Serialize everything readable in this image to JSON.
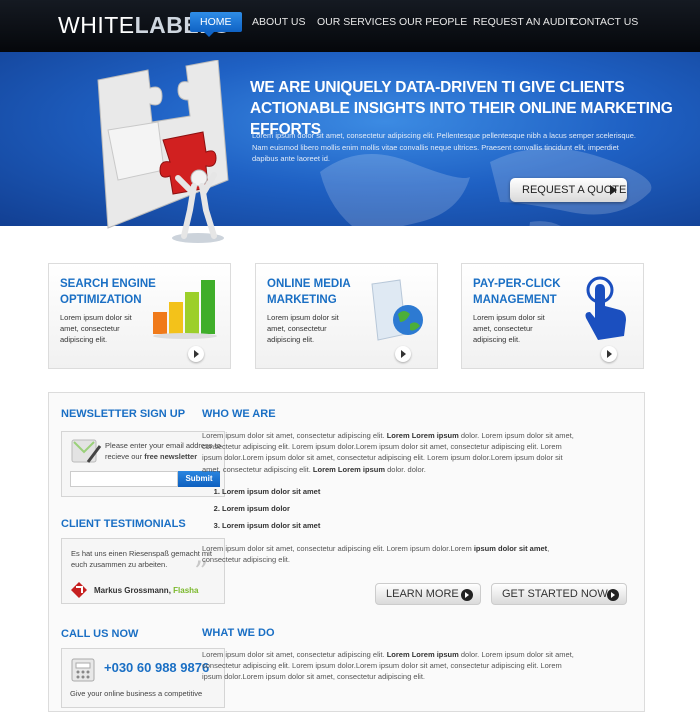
{
  "logo": {
    "part1": "WHITE",
    "part2": "LABELS"
  },
  "nav": {
    "items": [
      "HOME",
      "ABOUT US",
      "OUR SERVICES",
      "OUR PEOPLE",
      "REQUEST AN AUDIT",
      "CONTACT US"
    ]
  },
  "hero": {
    "title": "WE ARE UNIQUELY DATA-DRIVEN TI GIVE CLIENTS ACTIONABLE INSIGHTS INTO THEIR ONLINE MARKETING EFFORTS",
    "text": "Lorem ipsum dolor sit amet, consectetur adipiscing elit. Pellentesque pellentesque nibh a lacus semper scelerisque. Nam euismod libero mollis enim mollis vitae convallis neque ultrices. Praesent convallis tincidunt elit, imperdiet dapibus ante laoreet id.",
    "button": "REQUEST A QUOTE"
  },
  "services": [
    {
      "title": "SEARCH ENGINE OPTIMIZATION",
      "text": "Lorem ipsum dolor sit amet, consectetur adipiscing elit.",
      "icon": "bar-chart-icon"
    },
    {
      "title": "ONLINE MEDIA MARKETING",
      "text": "Lorem ipsum dolor sit amet, consectetur adipiscing elit.",
      "icon": "globe-folder-icon"
    },
    {
      "title": "PAY-PER-CLICK MANAGEMENT",
      "text": "Lorem ipsum dolor sit amet, consectetur adipiscing elit.",
      "icon": "hand-pointer-icon"
    }
  ],
  "newsletter": {
    "heading": "NEWSLETTER SIGN UP",
    "text1": "Please enter your email address to recieve our",
    "text2": "free newsletter",
    "button": "Submit"
  },
  "testimonials": {
    "heading": "CLIENT TESTIMONIALS",
    "text": "Es hat uns einen Riesenspaß gemacht mit euch zusammen zu arbeiten.",
    "name": "Markus Grossmann,",
    "company": "Flasha"
  },
  "call": {
    "heading": "CALL US NOW",
    "phone": "+030 60 988 9876",
    "text": "Give your online business a competitive"
  },
  "who": {
    "heading": "WHO WE ARE",
    "p1a": "Lorem ipsum dolor sit amet, consectetur adipiscing elit.",
    "p1b": "Lorem Lorem ipsum",
    "p1c": "dolor. Lorem ipsum dolor sit amet, consectetur adipiscing elit. Lorem  ipsum dolor.Lorem ipsum dolor sit amet, consectetur adipiscing elit. Lorem ipsum dolor.Lorem ipsum dolor sit amet, consectetur adipiscing elit. Lorem ipsum dolor.Lorem ipsum dolor sit amet, consectetur adipiscing elit.",
    "p1d": "Lorem Lorem ipsum",
    "p1e": "dolor. dolor.",
    "list": [
      "Lorem ipsum dolor sit amet",
      "Lorem ipsum dolor",
      "Lorem ipsum dolor sit amet"
    ],
    "p2a": "Lorem ipsum dolor sit amet, consectetur adipiscing elit. Lorem ipsum dolor.Lorem",
    "p2b": "ipsum dolor sit amet",
    "p2c": ", consectetur adipiscing elit.",
    "learn": "LEARN MORE",
    "started": "GET STARTED NOW"
  },
  "what": {
    "heading": "WHAT WE DO",
    "p1a": "Lorem ipsum dolor sit amet, consectetur adipiscing elit.",
    "p1b": "Lorem Lorem ipsum",
    "p1c": "dolor. Lorem ipsum dolor sit amet, consectetur adipiscing elit. Lorem  ipsum dolor.Lorem ipsum dolor sit amet, consectetur adipiscing elit. Lorem ipsum dolor.Lorem ipsum dolor sit amet, consectetur adipiscing elit."
  },
  "colors": {
    "accent": "#1a6fc4",
    "hero": "#1f61c4",
    "header": "#0b0e14"
  }
}
